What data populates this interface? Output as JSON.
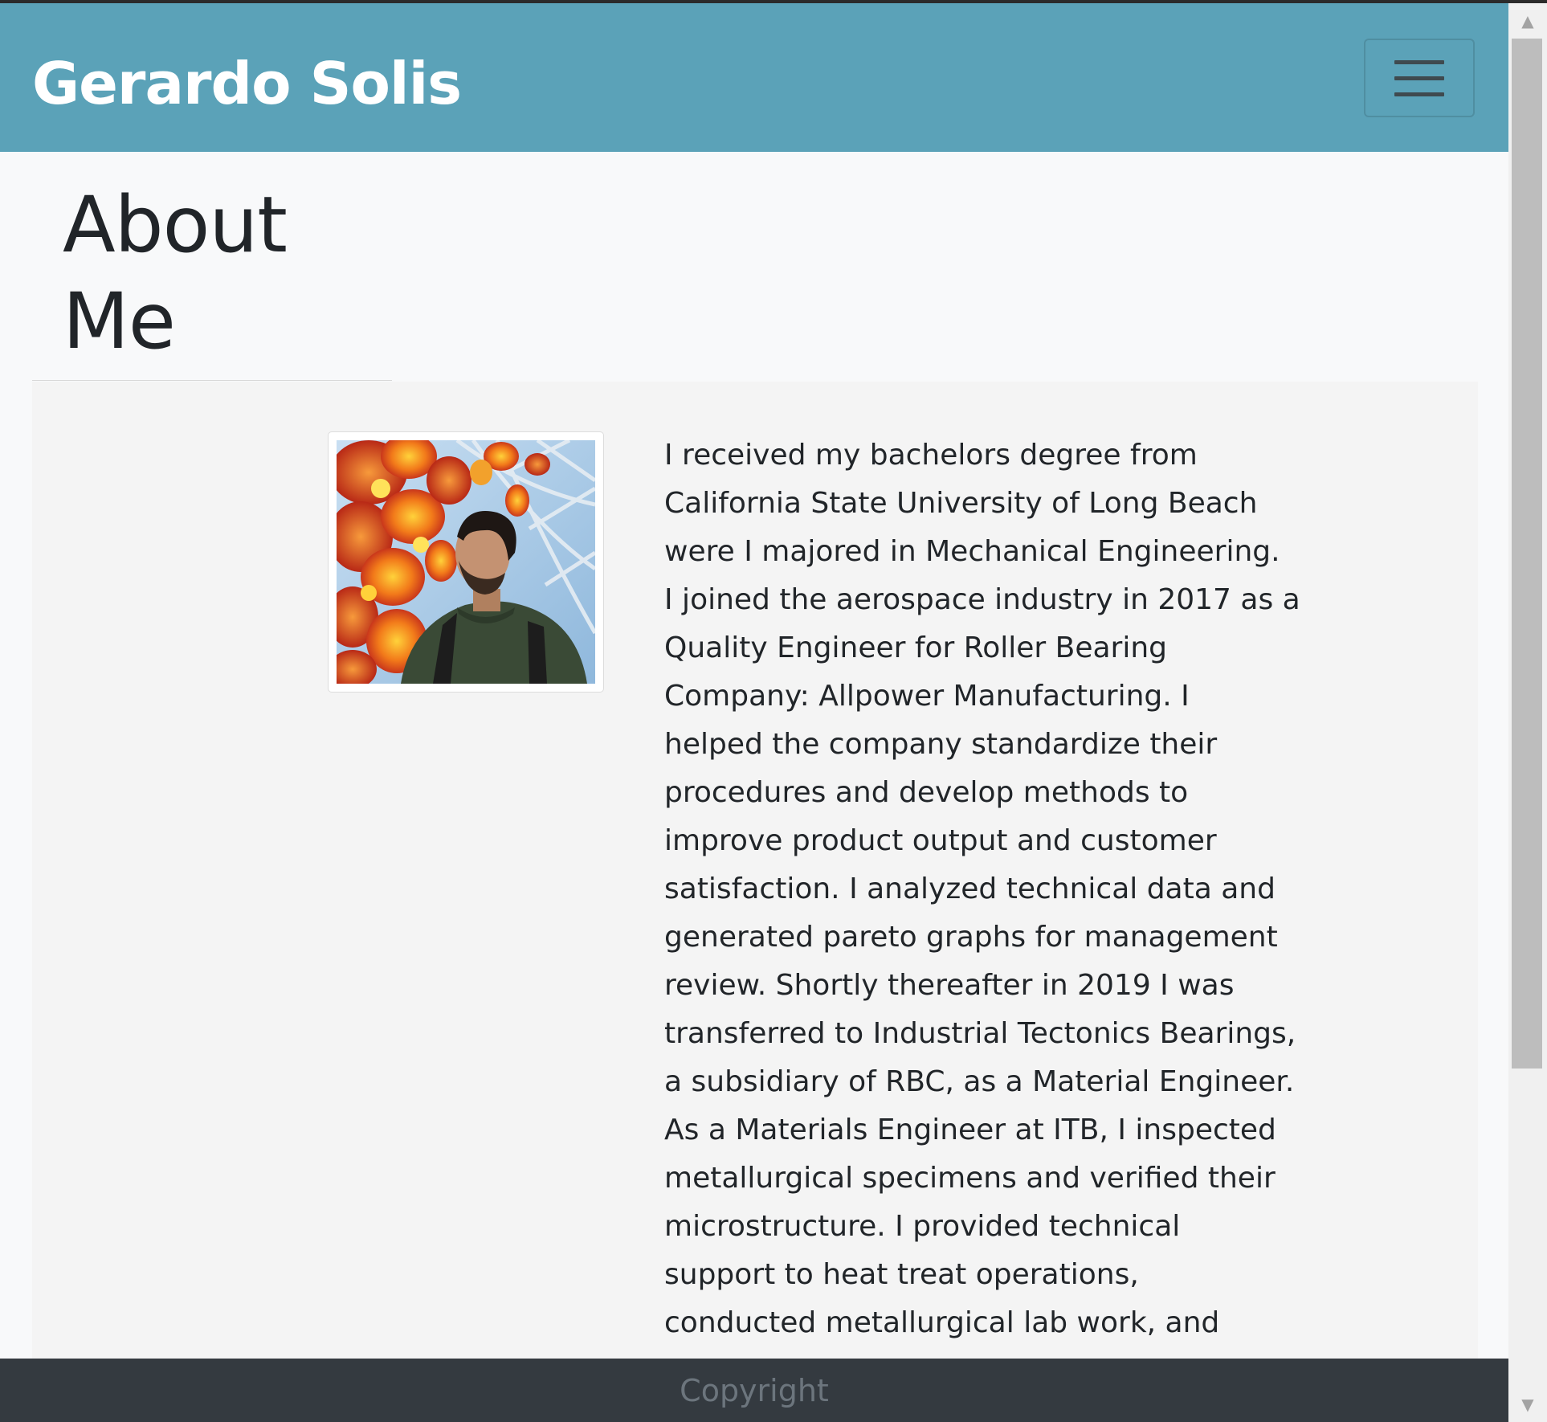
{
  "navbar": {
    "brand": "Gerardo Solis",
    "toggler_icon": "hamburger-menu-icon"
  },
  "about": {
    "title_line1": "About",
    "title_line2": "Me",
    "photo_alt": "Gerardo Solis portrait",
    "bio": "I received my bachelors degree from\nCalifornia State University of Long Beach\nwere I majored in Mechanical Engineering.\nI joined the aerospace industry in 2017 as a\nQuality Engineer for Roller Bearing\nCompany: Allpower Manufacturing. I\nhelped the company standardize their\nprocedures and develop methods to\nimprove product output and customer\nsatisfaction. I analyzed technical data and\ngenerated pareto graphs for management\nreview. Shortly thereafter in 2019 I was\ntransferred to Industrial Tectonics Bearings,\na subsidiary of RBC, as a Material Engineer.\nAs a Materials Engineer at ITB, I inspected\nmetallurgical specimens and verified their\nmicrostructure. I provided technical\nsupport to heat treat operations,\nconducted metallurgical lab work, and"
  },
  "footer": {
    "text": "Copyright"
  },
  "scrollbar": {
    "up_arrow": "▲",
    "down_arrow": "▼"
  },
  "colors": {
    "navbar_bg": "#5ba2b8",
    "footer_bg": "#343a40",
    "footer_text": "#6c757d",
    "content_bg": "#f4f4f4"
  }
}
